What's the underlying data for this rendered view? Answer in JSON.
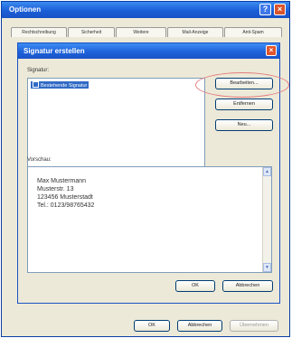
{
  "outer_window": {
    "title": "Optionen",
    "help_label": "?",
    "close_label": "×",
    "tabs": [
      "Rechtschreibung",
      "Sicherheit",
      "Weitere",
      "Mail-Anzeige",
      "Anti-Spam"
    ],
    "ok_label": "OK",
    "cancel_label": "Abbrechen",
    "apply_label": "Übernehmen"
  },
  "dialog": {
    "title": "Signatur erstellen",
    "close_label": "×",
    "signature_label": "Signatur:",
    "signatures": [
      "Bestehende Signatur"
    ],
    "edit_label": "Bearbeiten...",
    "remove_label": "Entfernen",
    "new_label": "Neu...",
    "preview_label": "Vorschau:",
    "preview_lines": [
      "Max Mustermann",
      "Musterstr. 13",
      "123456 Musterstadt",
      "Tel.: 0123/98765432"
    ],
    "ok_label": "OK",
    "cancel_label": "Abbrechen"
  }
}
